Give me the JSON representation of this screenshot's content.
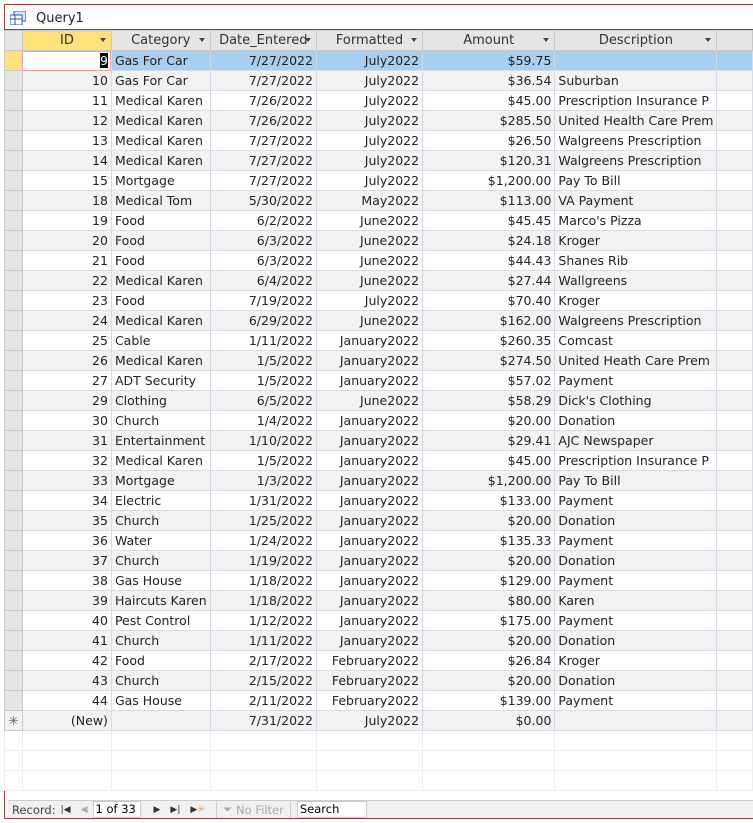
{
  "window": {
    "title": "Query1",
    "icon": "query-icon"
  },
  "columns": [
    "ID",
    "Category",
    "Date_Entered",
    "Formatted",
    "Amount",
    "Description"
  ],
  "rows": [
    [
      "9",
      "Gas For Car",
      "7/27/2022",
      "July2022",
      "$59.75",
      ""
    ],
    [
      "10",
      "Gas For Car",
      "7/27/2022",
      "July2022",
      "$36.54",
      "Suburban"
    ],
    [
      "11",
      "Medical Karen",
      "7/26/2022",
      "July2022",
      "$45.00",
      "Prescription Insurance P"
    ],
    [
      "12",
      "Medical Karen",
      "7/26/2022",
      "July2022",
      "$285.50",
      "United Health Care Prem"
    ],
    [
      "13",
      "Medical Karen",
      "7/27/2022",
      "July2022",
      "$26.50",
      "Walgreens Prescription"
    ],
    [
      "14",
      "Medical Karen",
      "7/27/2022",
      "July2022",
      "$120.31",
      "Walgreens Prescription"
    ],
    [
      "15",
      "Mortgage",
      "7/27/2022",
      "July2022",
      "$1,200.00",
      "Pay To Bill"
    ],
    [
      "18",
      "Medical Tom",
      "5/30/2022",
      "May2022",
      "$113.00",
      "VA Payment"
    ],
    [
      "19",
      "Food",
      "6/2/2022",
      "June2022",
      "$45.45",
      "Marco's Pizza"
    ],
    [
      "20",
      "Food",
      "6/3/2022",
      "June2022",
      "$24.18",
      "Kroger"
    ],
    [
      "21",
      "Food",
      "6/3/2022",
      "June2022",
      "$44.43",
      "Shanes Rib"
    ],
    [
      "22",
      "Medical Karen",
      "6/4/2022",
      "June2022",
      "$27.44",
      "Wallgreens"
    ],
    [
      "23",
      "Food",
      "7/19/2022",
      "July2022",
      "$70.40",
      "Kroger"
    ],
    [
      "24",
      "Medical Karen",
      "6/29/2022",
      "June2022",
      "$162.00",
      "Walgreens Prescription"
    ],
    [
      "25",
      "Cable",
      "1/11/2022",
      "January2022",
      "$260.35",
      "Comcast"
    ],
    [
      "26",
      "Medical Karen",
      "1/5/2022",
      "January2022",
      "$274.50",
      "United Heath Care Prem"
    ],
    [
      "27",
      "ADT Security",
      "1/5/2022",
      "January2022",
      "$57.02",
      "Payment"
    ],
    [
      "29",
      "Clothing",
      "6/5/2022",
      "June2022",
      "$58.29",
      "Dick's Clothing"
    ],
    [
      "30",
      "Church",
      "1/4/2022",
      "January2022",
      "$20.00",
      "Donation"
    ],
    [
      "31",
      "Entertainment",
      "1/10/2022",
      "January2022",
      "$29.41",
      "AJC Newspaper"
    ],
    [
      "32",
      "Medical Karen",
      "1/5/2022",
      "January2022",
      "$45.00",
      "Prescription Insurance P"
    ],
    [
      "33",
      "Mortgage",
      "1/3/2022",
      "January2022",
      "$1,200.00",
      "Pay To Bill"
    ],
    [
      "34",
      "Electric",
      "1/31/2022",
      "January2022",
      "$133.00",
      "Payment"
    ],
    [
      "35",
      "Church",
      "1/25/2022",
      "January2022",
      "$20.00",
      "Donation"
    ],
    [
      "36",
      "Water",
      "1/24/2022",
      "January2022",
      "$135.33",
      "Payment"
    ],
    [
      "37",
      "Church",
      "1/19/2022",
      "January2022",
      "$20.00",
      "Donation"
    ],
    [
      "38",
      "Gas House",
      "1/18/2022",
      "January2022",
      "$129.00",
      "Payment"
    ],
    [
      "39",
      "Haircuts Karen",
      "1/18/2022",
      "January2022",
      "$80.00",
      "Karen"
    ],
    [
      "40",
      "Pest Control",
      "1/12/2022",
      "January2022",
      "$175.00",
      "Payment"
    ],
    [
      "41",
      "Church",
      "1/11/2022",
      "January2022",
      "$20.00",
      "Donation"
    ],
    [
      "42",
      "Food",
      "2/17/2022",
      "February2022",
      "$26.84",
      "Kroger"
    ],
    [
      "43",
      "Church",
      "2/15/2022",
      "February2022",
      "$20.00",
      "Donation"
    ],
    [
      "44",
      "Gas House",
      "2/11/2022",
      "February2022",
      "$139.00",
      "Payment"
    ]
  ],
  "new_row": {
    "marker": "✳",
    "id": "(New)",
    "date": "7/31/2022",
    "formatted": "July2022",
    "amount": "$0.00"
  },
  "nav": {
    "label": "Record:",
    "position": "1 of 33",
    "filter": "No Filter",
    "search": "Search"
  }
}
